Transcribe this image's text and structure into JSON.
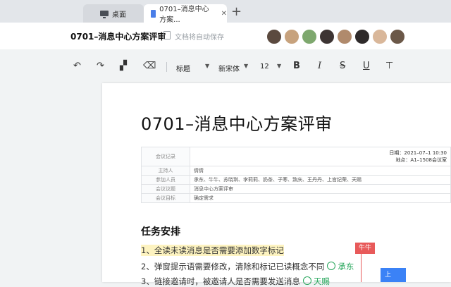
{
  "tabs": [
    {
      "label": "桌面",
      "icon": "monitor-icon"
    },
    {
      "label": "0701–消息中心方案...",
      "icon": "document-icon"
    }
  ],
  "header": {
    "title": "0701–消息中心方案评审",
    "save_status": "文档将自动保存"
  },
  "toolbar": {
    "style": "标题",
    "font": "新宋体",
    "size": "12"
  },
  "document": {
    "title": "0701–消息中心方案评审",
    "meeting_table": {
      "header_label": "会议记录",
      "date": "日期：2021–07–1 10:30",
      "location": "地点：A1–1508会议室",
      "rows": [
        {
          "label": "主持人",
          "value": "倩倩"
        },
        {
          "label": "参加人员",
          "value": "承东、牛牛、苏晓琪、李莉莉、奶茶、子寒、致庆、王丹丹、上官纪荣、天赐"
        },
        {
          "label": "会议议题",
          "value": "消息中心方案评审"
        },
        {
          "label": "会议目标",
          "value": "确定需求"
        }
      ]
    },
    "section_title": "任务安排",
    "tasks": [
      {
        "text": "1、全读未读消息是否需要添加数字标记",
        "assignee": ""
      },
      {
        "text": "2、弹窗提示语需要修改，清除和标记已读概念不同",
        "assignee": "承东"
      },
      {
        "text": "3、链接邀请时，被邀请人是否需要发送消息",
        "assignee": "天赐"
      }
    ]
  },
  "collaborators": {
    "cursor_label": "牛牛",
    "other_label": "上"
  },
  "colors": {
    "accent_blue": "#3b82f6",
    "cursor_red": "#e85a5a",
    "assignee_green": "#26a65b",
    "highlight": "#fdf3c0"
  }
}
